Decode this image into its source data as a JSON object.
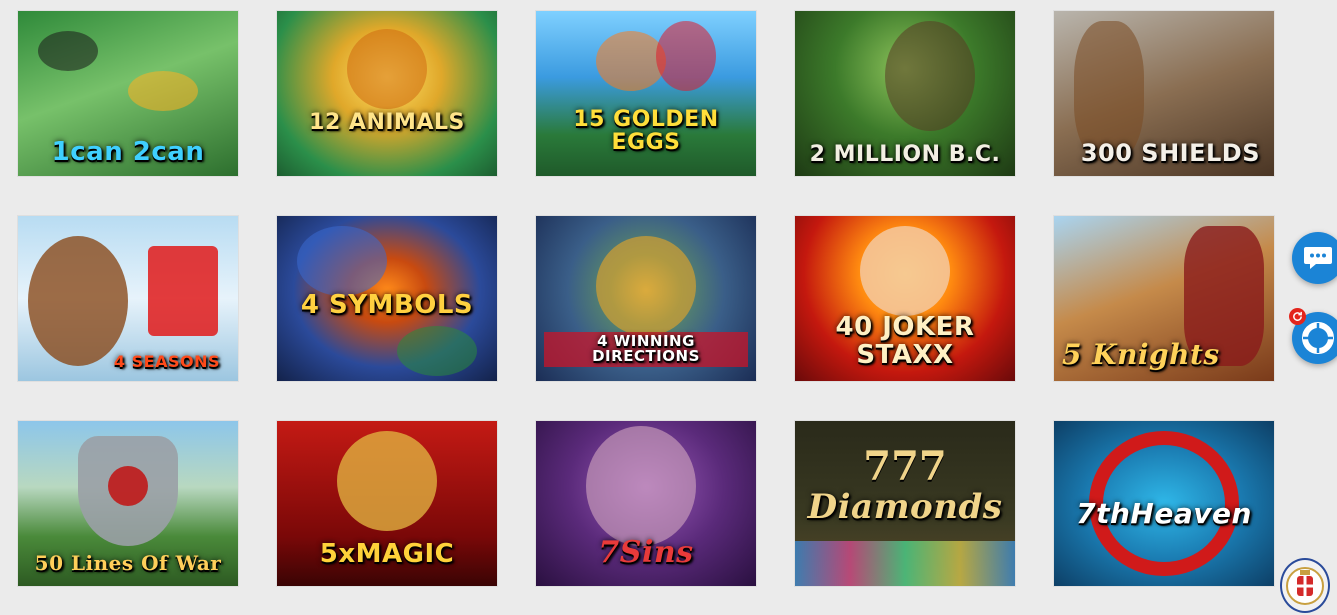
{
  "games": [
    {
      "title": "1can 2can"
    },
    {
      "title": "12 ANIMALS"
    },
    {
      "title": "15 GOLDEN EGGS"
    },
    {
      "title": "2 MILLION B.C."
    },
    {
      "title": "300 SHIELDS"
    },
    {
      "title": "4 SEASONS"
    },
    {
      "title": "4 SYMBOLS"
    },
    {
      "title": "4 WINNING DIRECTIONS"
    },
    {
      "title": "40 JOKER STAXX"
    },
    {
      "title": "5 Knights"
    },
    {
      "title": "50 Lines Of War"
    },
    {
      "title": "5xMAGIC"
    },
    {
      "title": "7Sins"
    },
    {
      "title": "Diamonds",
      "number": "777"
    },
    {
      "title": "7thHeaven"
    }
  ],
  "widgets": {
    "chat_icon": "chat-bubble-icon",
    "support_icon": "lifebuoy-icon",
    "refresh_icon": "refresh-icon",
    "seal_icon": "license-seal-icon",
    "accent_color": "#1b84d6",
    "alert_color": "#e3251c"
  }
}
